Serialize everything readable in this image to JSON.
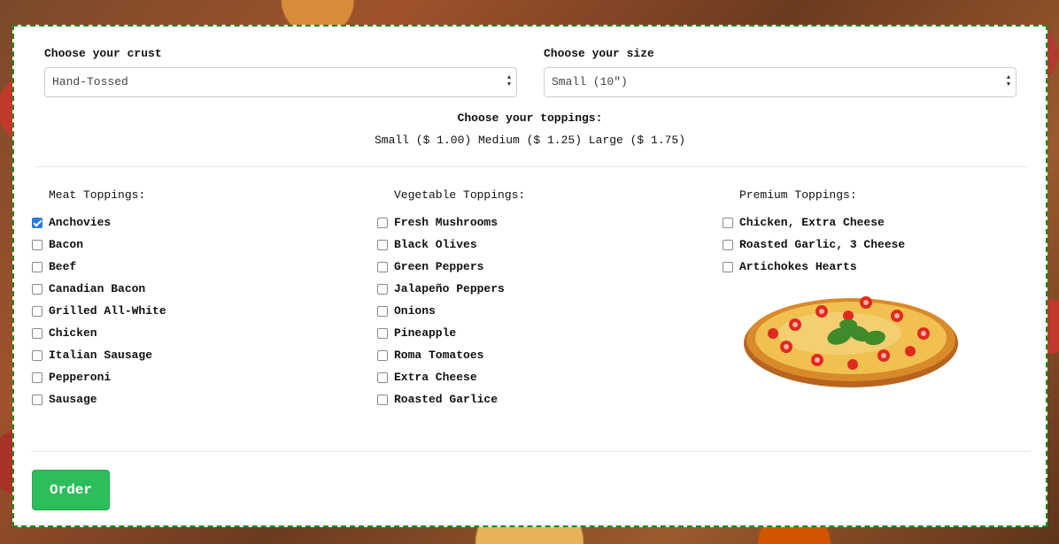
{
  "crust": {
    "label": "Choose your crust",
    "selected": "Hand-Tossed"
  },
  "size": {
    "label": "Choose your size",
    "selected": "Small (10\")"
  },
  "toppings": {
    "title": "Choose your toppings:",
    "prices": "Small ($ 1.00) Medium ($ 1.25) Large ($ 1.75)",
    "meat": {
      "heading": "Meat Toppings:",
      "items": [
        {
          "label": "Anchovies",
          "checked": true
        },
        {
          "label": "Bacon",
          "checked": false
        },
        {
          "label": "Beef",
          "checked": false
        },
        {
          "label": "Canadian Bacon",
          "checked": false
        },
        {
          "label": "Grilled All-White",
          "checked": false
        },
        {
          "label": "Chicken",
          "checked": false
        },
        {
          "label": "Italian Sausage",
          "checked": false
        },
        {
          "label": "Pepperoni",
          "checked": false
        },
        {
          "label": "Sausage",
          "checked": false
        }
      ]
    },
    "vegetable": {
      "heading": "Vegetable Toppings:",
      "items": [
        {
          "label": "Fresh Mushrooms",
          "checked": false
        },
        {
          "label": "Black Olives",
          "checked": false
        },
        {
          "label": "Green Peppers",
          "checked": false
        },
        {
          "label": "Jalapeño Peppers",
          "checked": false
        },
        {
          "label": "Onions",
          "checked": false
        },
        {
          "label": "Pineapple",
          "checked": false
        },
        {
          "label": "Roma Tomatoes",
          "checked": false
        },
        {
          "label": "Extra Cheese",
          "checked": false
        },
        {
          "label": "Roasted Garlice",
          "checked": false
        }
      ]
    },
    "premium": {
      "heading": "Premium Toppings:",
      "items": [
        {
          "label": "Chicken, Extra Cheese",
          "checked": false
        },
        {
          "label": "Roasted Garlic, 3 Cheese",
          "checked": false
        },
        {
          "label": "Artichokes Hearts",
          "checked": false
        }
      ]
    }
  },
  "order_button": {
    "label": "Order"
  },
  "colors": {
    "card_border": "#1a8a1a",
    "checkbox_checked": "#2a7ae4",
    "order_button": "#2dbd5a"
  }
}
